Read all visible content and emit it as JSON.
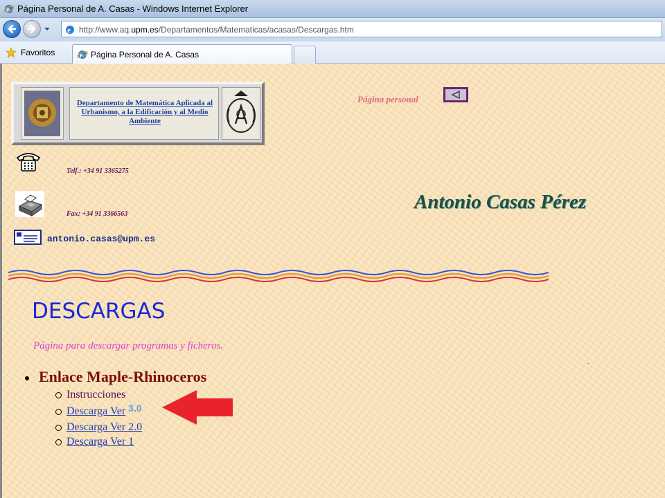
{
  "window": {
    "title": "Página Personal de A. Casas - Windows Internet Explorer"
  },
  "address_bar": {
    "url_prefix": "http://www.aq.",
    "url_domain": "upm.es",
    "url_path": "/Departamentos/Matematicas/acasas/Descargas.htm"
  },
  "favorites_bar": {
    "favorites_label": "Favoritos",
    "tab_label": "Página Personal de A. Casas"
  },
  "page": {
    "department_link": "Departamento de Matemática Aplicada al Urbanismo, a la Edificación y al Medio Ambiente",
    "personal_label": "Página personal",
    "phone": "Telf.: +34 91 3365275",
    "fax": "Fax: +34 91 3366563",
    "email": "antonio.casas@upm.es",
    "owner_name": "Antonio Casas Pérez",
    "heading": "DESCARGAS",
    "subtitle": "Página para descargar programas y ficheros.",
    "dot": ".",
    "section": {
      "title": "Enlace Maple-Rhinoceros",
      "instructions": "Instrucciones",
      "download_3_label": "Descarga Ver",
      "download_3_version": "3.0",
      "download_2": "Descarga Ver 2.0",
      "download_1": "Descarga Ver 1"
    }
  },
  "colors": {
    "page_background": "#f8e2bb",
    "heading": "#1a2ad6",
    "subtitle": "#e03bd0",
    "section_title": "#7a1010",
    "link": "#1d3fb8",
    "owner_name": "#1c4f46",
    "annotation_arrow": "#e8232b"
  }
}
